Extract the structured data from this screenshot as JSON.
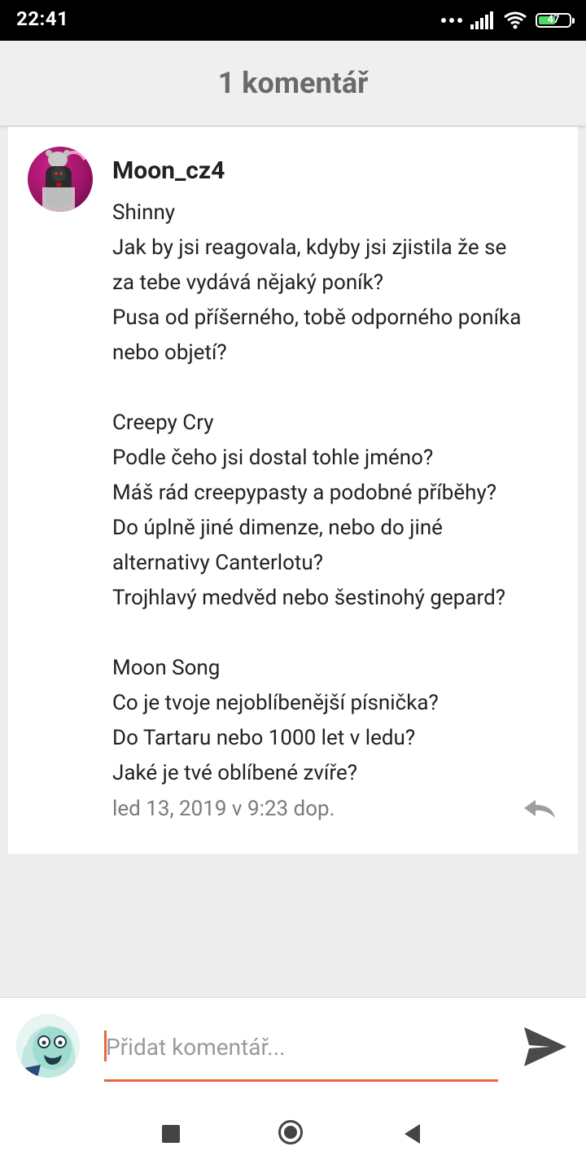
{
  "status_bar": {
    "time": "22:41",
    "battery_level": "47",
    "icons": [
      "more-dots-icon",
      "signal-icon",
      "wifi-icon",
      "battery-icon"
    ]
  },
  "header": {
    "title": "1 komentář"
  },
  "comment": {
    "author": "Moon_cz4",
    "lines": [
      "Shinny",
      "Jak by jsi reagovala, kdyby jsi zjistila že se",
      "za tebe vydává nějaký poník?",
      "Pusa od příšerného, tobě odporného poníka",
      "nebo objetí?",
      "",
      "Creepy Cry",
      "Podle čeho jsi dostal tohle jméno?",
      "Máš rád creepypasty a podobné příběhy?",
      "Do úplně jiné dimenze, nebo do jiné",
      "alternativy Canterlotu?",
      "Trojhlavý medvěd nebo  šestinohý gepard?",
      "",
      "Moon Song",
      "Co je tvoje nejoblíbenější písnička?",
      "Do Tartaru nebo 1000 let v ledu?",
      "Jaké je tvé oblíbené zvíře?"
    ],
    "timestamp": "led 13, 2019 v 9:23 dop."
  },
  "composer": {
    "placeholder": "Přidat komentář...",
    "value": ""
  },
  "colors": {
    "accent": "#e8683a",
    "header_text": "#6a6a6a",
    "timestamp": "#7a7a7a"
  }
}
